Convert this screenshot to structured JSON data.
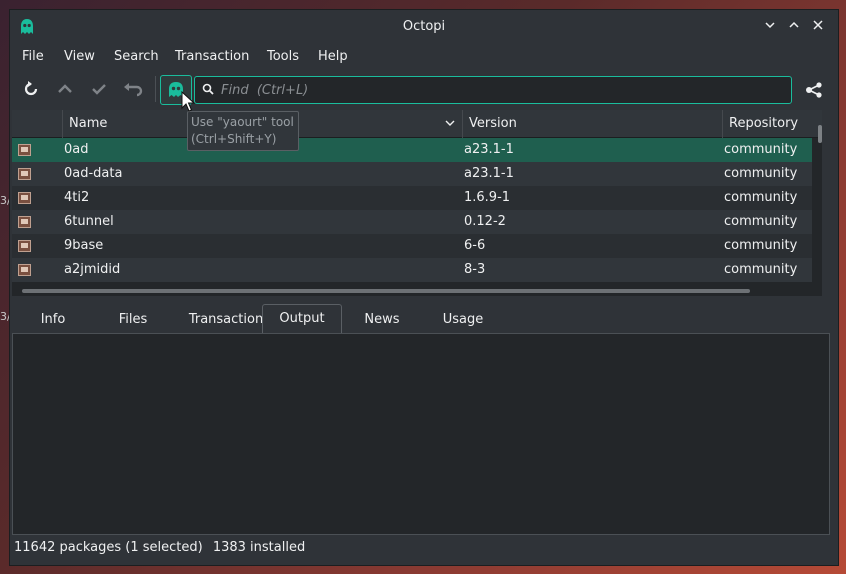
{
  "window": {
    "title": "Octopi",
    "controls": [
      "minimize",
      "maximize",
      "close"
    ]
  },
  "menu": [
    "File",
    "View",
    "Search",
    "Transaction",
    "Tools",
    "Help"
  ],
  "toolbar": {
    "buttons": [
      "sync-icon",
      "upgrade-icon",
      "commit-icon",
      "rollback-icon",
      "yaourt-icon"
    ],
    "search": {
      "placeholder": "Find  (Ctrl+L)",
      "value": ""
    },
    "tooltip": {
      "line1": "Use \"yaourt\" tool",
      "line2": "(Ctrl+Shift+Y)"
    }
  },
  "table": {
    "columns": [
      "",
      "Name",
      "Version",
      "Repository"
    ],
    "rows": [
      {
        "name": "0ad",
        "version": "a23.1-1",
        "repository": "community",
        "selected": true
      },
      {
        "name": "0ad-data",
        "version": "a23.1-1",
        "repository": "community",
        "selected": false
      },
      {
        "name": "4ti2",
        "version": "1.6.9-1",
        "repository": "community",
        "selected": false
      },
      {
        "name": "6tunnel",
        "version": "0.12-2",
        "repository": "community",
        "selected": false
      },
      {
        "name": "9base",
        "version": "6-6",
        "repository": "community",
        "selected": false
      },
      {
        "name": "a2jmidid",
        "version": "8-3",
        "repository": "community",
        "selected": false
      }
    ]
  },
  "tabs": [
    {
      "label": "Info",
      "active": false
    },
    {
      "label": "Files",
      "active": false
    },
    {
      "label": "Transaction",
      "active": false
    },
    {
      "label": "Output",
      "active": true
    },
    {
      "label": "News",
      "active": false
    },
    {
      "label": "Usage",
      "active": false
    }
  ],
  "status": {
    "packages": "11642 packages (1 selected)",
    "installed": "1383 installed"
  },
  "colors": {
    "accent": "#1abc9c",
    "selection": "#1f5f4f",
    "window_bg": "#2f3338"
  }
}
